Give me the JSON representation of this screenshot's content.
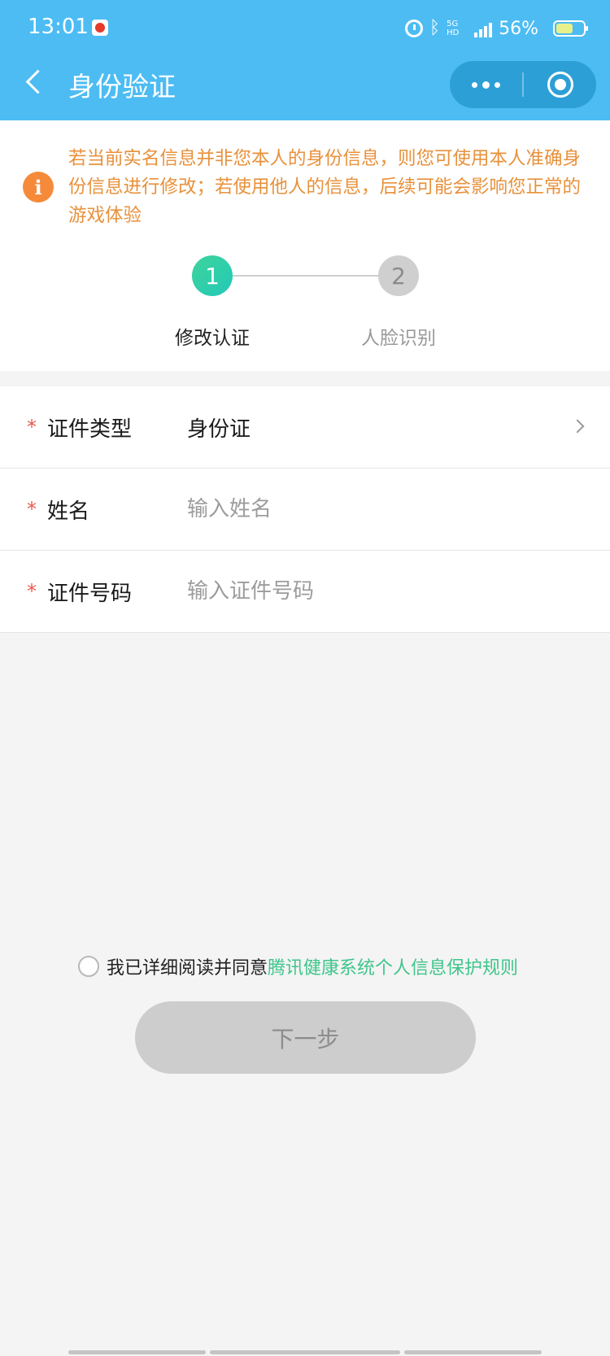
{
  "status_bar": {
    "time": "13:01",
    "network_label": "5G HD",
    "battery": "56%"
  },
  "nav": {
    "title": "身份验证"
  },
  "notice": {
    "text": "若当前实名信息并非您本人的身份信息，则您可使用本人准确身份信息进行修改；若使用他人的信息，后续可能会影响您正常的游戏体验",
    "icon_glyph": "i"
  },
  "steps": [
    {
      "number": "1",
      "label": "修改认证",
      "active": true
    },
    {
      "number": "2",
      "label": "人脸识别",
      "active": false
    }
  ],
  "form": {
    "required_mark": "*",
    "id_type": {
      "label": "证件类型",
      "value": "身份证"
    },
    "name": {
      "label": "姓名",
      "placeholder": "输入姓名"
    },
    "id_number": {
      "label": "证件号码",
      "placeholder": "输入证件号码"
    }
  },
  "agreement": {
    "prefix": "我已详细阅读并同意",
    "link": "腾讯健康系统个人信息保护规则"
  },
  "next_button": {
    "label": "下一步"
  },
  "colors": {
    "header_bg": "#4cbcf3",
    "notice_text": "#e8913b",
    "active_step": "#2fcfa6",
    "link": "#3fc58b",
    "required": "#e85a4f"
  }
}
